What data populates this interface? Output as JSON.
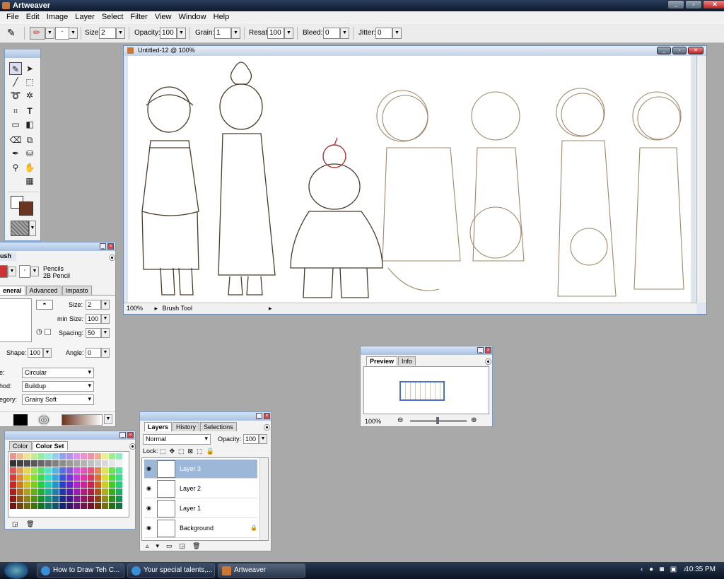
{
  "app": {
    "title": "Artweaver"
  },
  "menu": [
    "File",
    "Edit",
    "Image",
    "Layer",
    "Select",
    "Filter",
    "View",
    "Window",
    "Help"
  ],
  "options": {
    "size_label": "Size:",
    "size": "2",
    "opacity_label": "Opacity:",
    "opacity": "100",
    "grain_label": "Grain:",
    "grain": "1",
    "resat_label": "Resat:",
    "resat": "100",
    "bleed_label": "Bleed:",
    "bleed": "0",
    "jitter_label": "Jitter:",
    "jitter": "0"
  },
  "document": {
    "title": "Untitled-12 @ 100%",
    "zoom": "100%",
    "status_tool": "Brush Tool"
  },
  "brush_panel": {
    "title": "ush",
    "category": "Pencils",
    "variant": "2B Pencil",
    "tabs": [
      "eneral",
      "Advanced",
      "Impasto"
    ],
    "size_label": "Size:",
    "size": "2",
    "min_size_label": "min Size:",
    "min_size": "100",
    "spacing_label": "Spacing:",
    "spacing": "50",
    "shape_label": "Shape:",
    "shape": "100",
    "angle_label": "Angle:",
    "angle": "0",
    "type_label": "e:",
    "type": "Circular",
    "method_label": "hod:",
    "method": "Buildup",
    "category_label": "egory:",
    "grain_category": "Grainy Soft"
  },
  "color_panel": {
    "tabs": [
      "Color",
      "Color Set"
    ]
  },
  "layers_panel": {
    "tabs": [
      "Layers",
      "History",
      "Selections"
    ],
    "mode": "Normal",
    "opacity_label": "Opacity:",
    "opacity": "100",
    "lock_label": "Lock:",
    "layers": [
      "Layer 3",
      "Layer 2",
      "Layer 1",
      "Background"
    ]
  },
  "preview_panel": {
    "tabs": [
      "Preview",
      "Info"
    ],
    "zoom": "100%"
  },
  "taskbar": {
    "items": [
      "How to Draw Teh C...",
      "Your special talents,...",
      "Artweaver"
    ],
    "clock": "10:35 PM"
  },
  "colors": {
    "foreground": "#ffffff",
    "background": "#6b3520",
    "sketch": "#8a6a44"
  }
}
